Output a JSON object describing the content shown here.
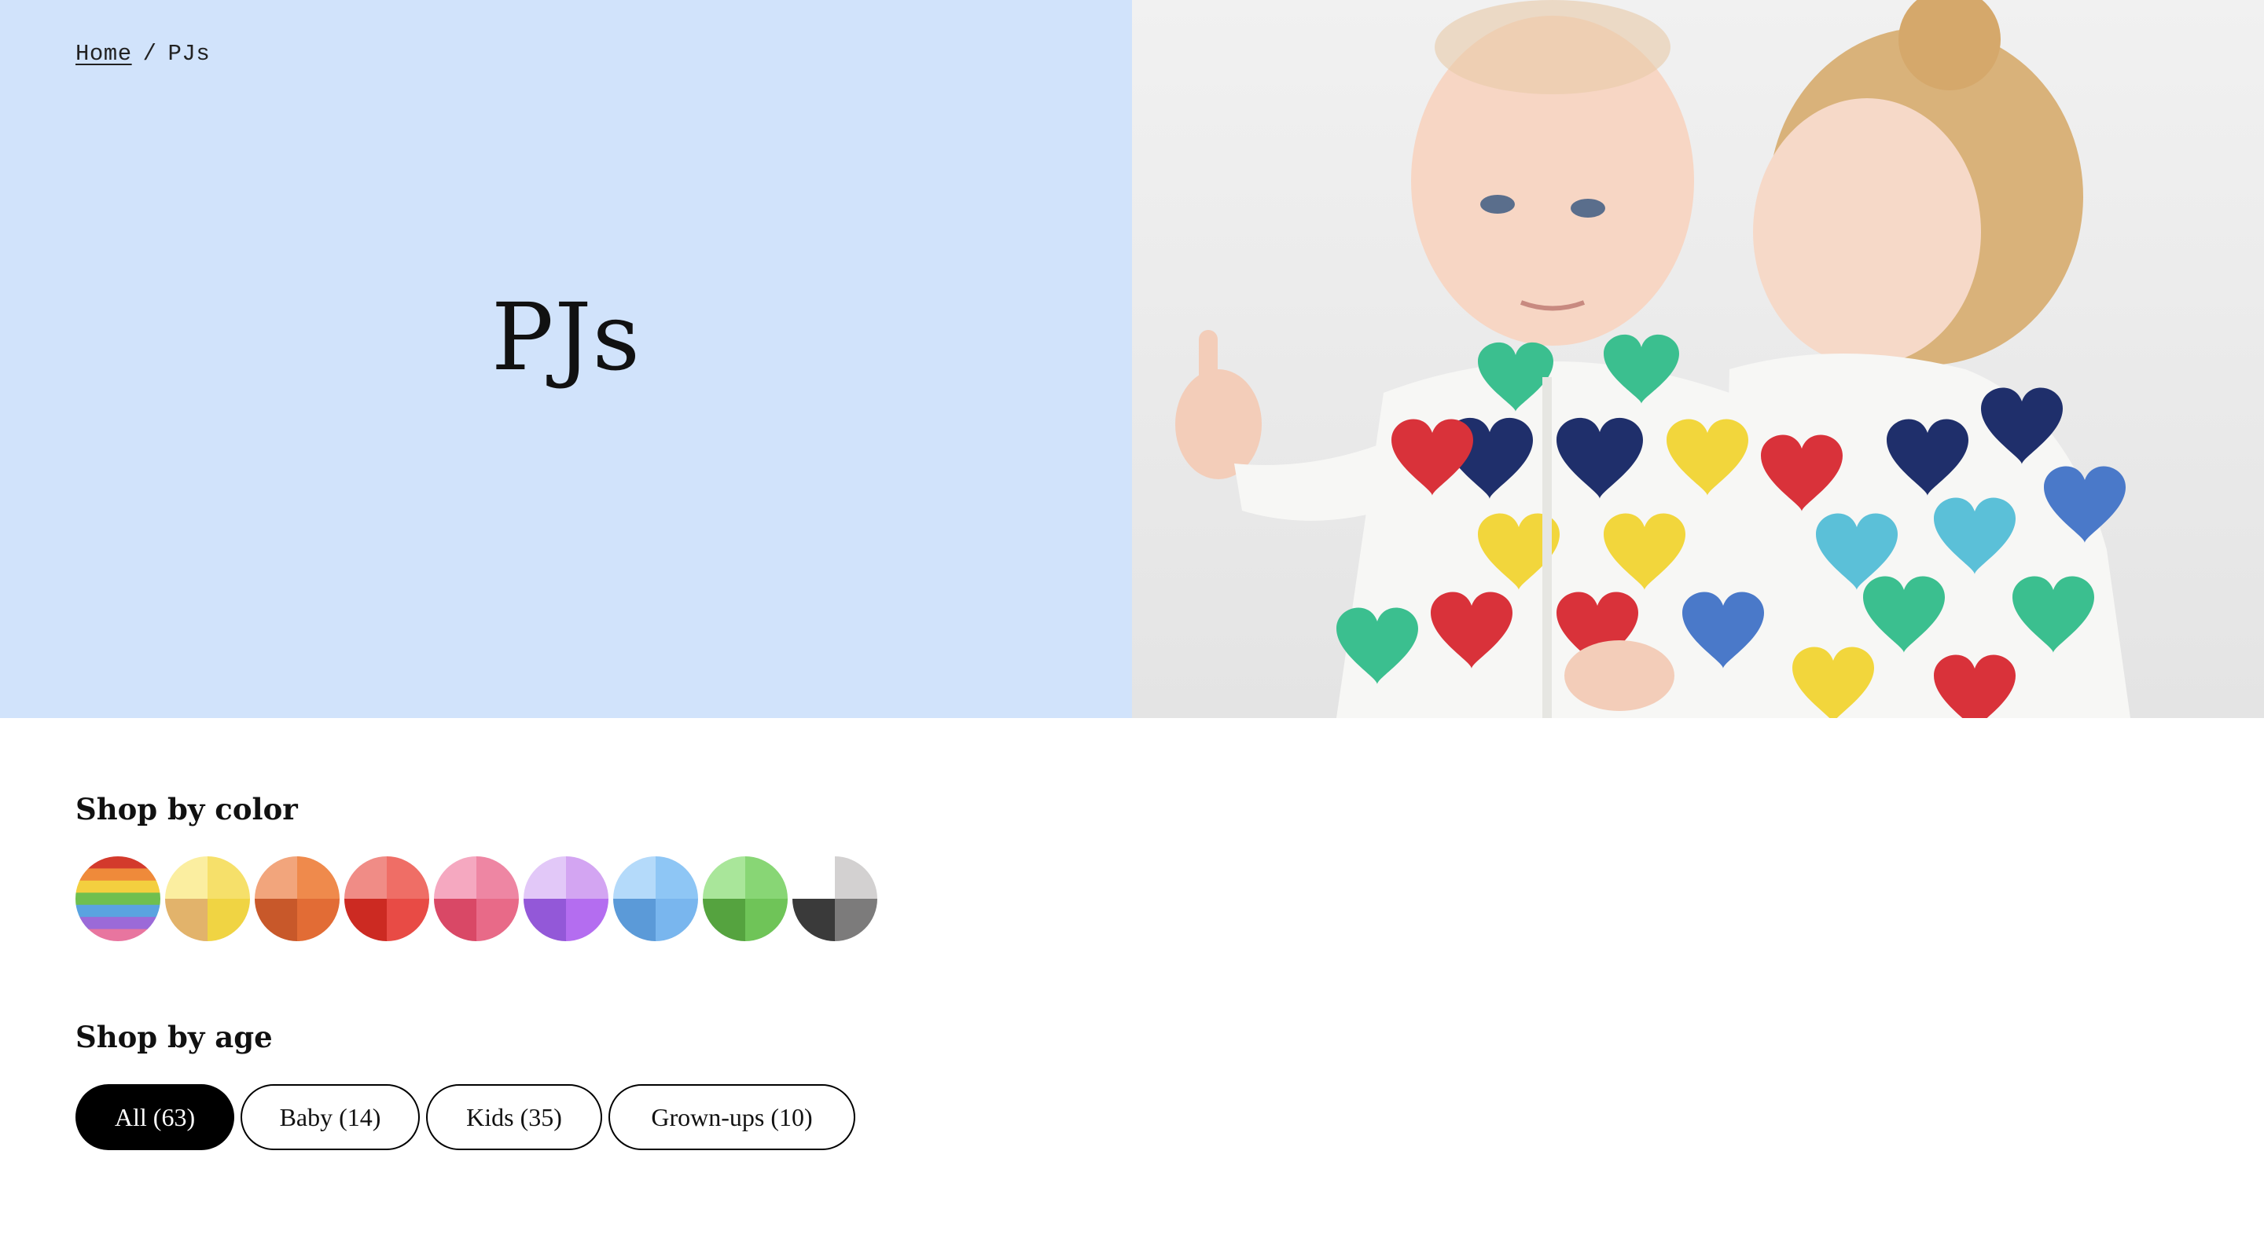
{
  "breadcrumb": {
    "home": "Home",
    "separator": "/",
    "current": "PJs"
  },
  "page": {
    "title": "PJs"
  },
  "hero_image": {
    "alt": "Baby and child in rainbow heart pajamas"
  },
  "shop_by_color": {
    "title": "Shop by color",
    "swatches": [
      {
        "name": "rainbow",
        "colors": [
          "#d33a2c",
          "#ef8a3a",
          "#f3cf3f",
          "#6fbf4f",
          "#5aa3e0",
          "#9b6ad8",
          "#e8759f"
        ]
      },
      {
        "name": "yellow",
        "colors": [
          "#fbeea0",
          "#f6e06a",
          "#e2b36b",
          "#f0d443"
        ]
      },
      {
        "name": "orange",
        "colors": [
          "#f2a57c",
          "#ef8a4c",
          "#c8582a",
          "#e26c35"
        ]
      },
      {
        "name": "red",
        "colors": [
          "#f08c86",
          "#ef6e66",
          "#cc2a22",
          "#e84b45"
        ]
      },
      {
        "name": "pink",
        "colors": [
          "#f5a8c0",
          "#ee86a3",
          "#d94866",
          "#e86a88"
        ]
      },
      {
        "name": "purple",
        "colors": [
          "#e2c8f8",
          "#d3a5f2",
          "#9358d8",
          "#b46df0"
        ]
      },
      {
        "name": "blue",
        "colors": [
          "#b4dafa",
          "#8ec6f5",
          "#5b9ad8",
          "#79b6ee"
        ]
      },
      {
        "name": "green",
        "colors": [
          "#a9e69a",
          "#88d675",
          "#55a33f",
          "#6fc458"
        ]
      },
      {
        "name": "black-gray",
        "colors": [
          "#ffffff",
          "#d3d1d1",
          "#3a3a3a",
          "#7c7b7b"
        ]
      }
    ]
  },
  "shop_by_age": {
    "title": "Shop by age",
    "filters": [
      {
        "label": "All (63)",
        "active": true
      },
      {
        "label": "Baby (14)",
        "active": false
      },
      {
        "label": "Kids (35)",
        "active": false
      },
      {
        "label": "Grown-ups (10)",
        "active": false
      }
    ]
  }
}
